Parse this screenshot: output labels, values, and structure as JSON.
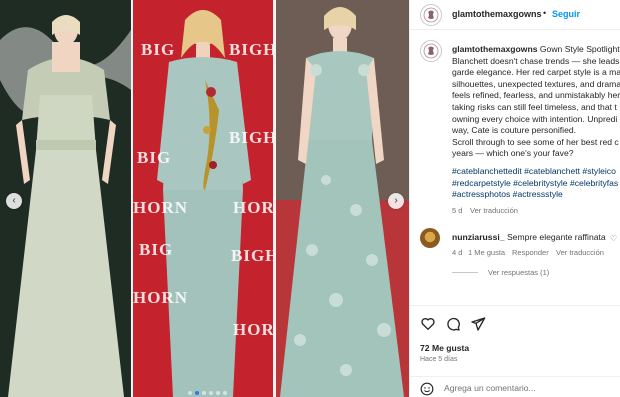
{
  "post": {
    "username": "glamtothemaxgowns",
    "separator": "•",
    "follow_label": "Seguir",
    "caption_lines": [
      "Gown Style Spotlight:",
      "Blanchett doesn't chase trends — she leads",
      "garde elegance. Her red carpet style is a ma",
      "silhouettes, unexpected textures, and drama",
      "feels refined, fearless, and unmistakably her.",
      "taking risks can still feel timeless, and that t",
      "owning every choice with intention. Unpredi",
      "way, Cate is couture personified.",
      "Scroll through to see some of her best red c",
      "years — which one's your fave?"
    ],
    "hashtag_lines": [
      "#cateblanchettedit #cateblanchett #styleico",
      "#redcarpetstyle #celebritystyle #celebrityfas",
      "#actressphotos #actressstyle"
    ],
    "caption_time": "5 d",
    "caption_translate": "Ver traducción"
  },
  "comment": {
    "username": "nunziarussi_",
    "text": "Sempre elegante raffinata",
    "time": "4 d",
    "likes": "1 Me gusta",
    "reply": "Responder",
    "translate": "Ver traducción",
    "view_replies": "Ver respuestas (1)"
  },
  "actions": {
    "likes_count": "72 Me gusta",
    "posted_ago": "Hace 5 días"
  },
  "add_comment": {
    "placeholder": "Agrega un comentario..."
  },
  "media": {
    "backdrop_text_1": [
      "BIG",
      "BIG",
      "HORN",
      "BIG",
      "BIGH",
      "HORN",
      "BIGH",
      "HORN",
      "BIGH",
      "HORN"
    ],
    "backdrop_text_2": [
      "BIG",
      "BIG",
      "BIG",
      "HORN",
      "HORN"
    ],
    "carousel_count": 6,
    "active_index": 1
  },
  "colors": {
    "accent": "#0095f6",
    "hashtag": "#00376b",
    "muted": "#737373",
    "dot_active": "#2a7be4"
  }
}
